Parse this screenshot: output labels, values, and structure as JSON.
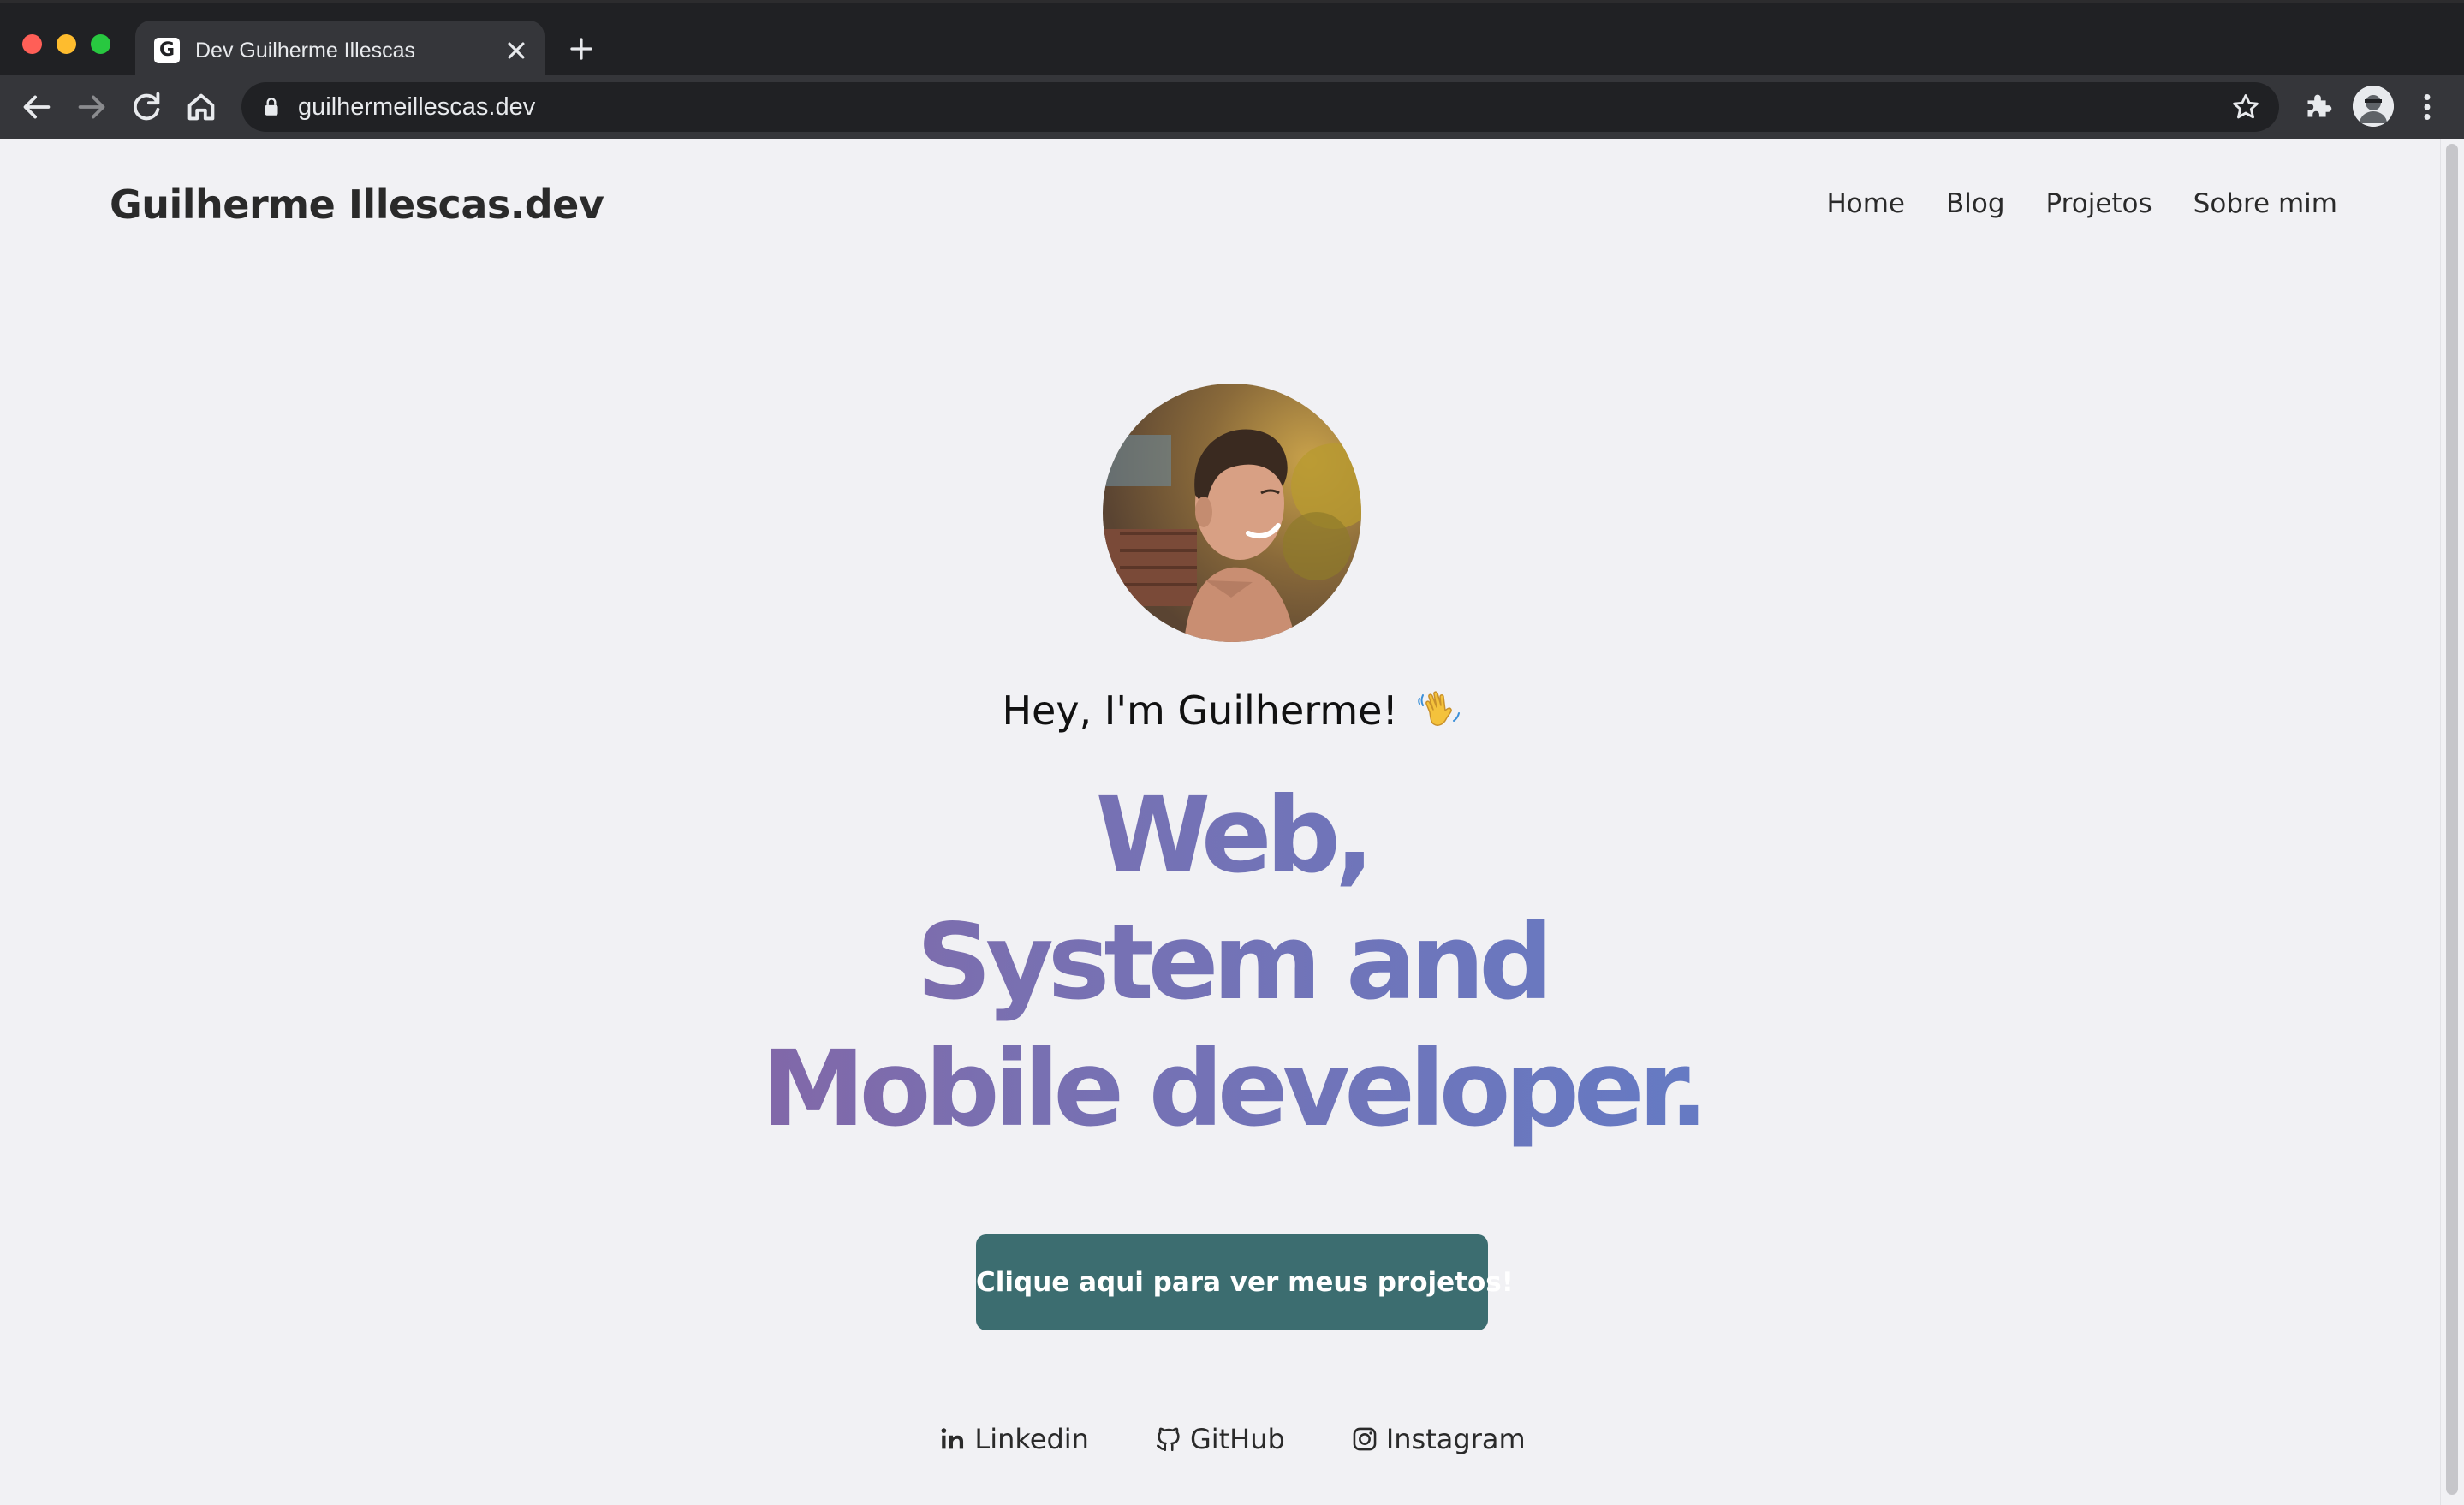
{
  "browser": {
    "tab_title": "Dev Guilherme Illescas",
    "favicon_letter": "G",
    "url": "guilhermeillescas.dev",
    "icons": [
      "close-icon",
      "plus-icon",
      "back-arrow-icon",
      "forward-arrow-icon",
      "reload-icon",
      "home-icon",
      "lock-icon",
      "star-icon",
      "puzzle-icon",
      "profile-avatar-icon",
      "kebab-menu-icon"
    ]
  },
  "site": {
    "brand": "Guilherme Illescas.dev",
    "nav": [
      "Home",
      "Blog",
      "Projetos",
      "Sobre mim"
    ]
  },
  "hero": {
    "greeting": "Hey, I'm Guilherme!",
    "wave_icon": "waving-hand-icon",
    "headline_lines": [
      "Web,",
      "System and",
      "Mobile developer."
    ],
    "gradient_colors": [
      "#9a4f8f",
      "#7a6fb0",
      "#4f86d8"
    ],
    "cta_label": "Clique aqui para ver meus projetos!",
    "cta_color": "#3c6d70"
  },
  "socials": [
    {
      "label": "Linkedin",
      "icon": "linkedin-icon"
    },
    {
      "label": "GitHub",
      "icon": "github-icon"
    },
    {
      "label": "Instagram",
      "icon": "instagram-icon"
    }
  ]
}
